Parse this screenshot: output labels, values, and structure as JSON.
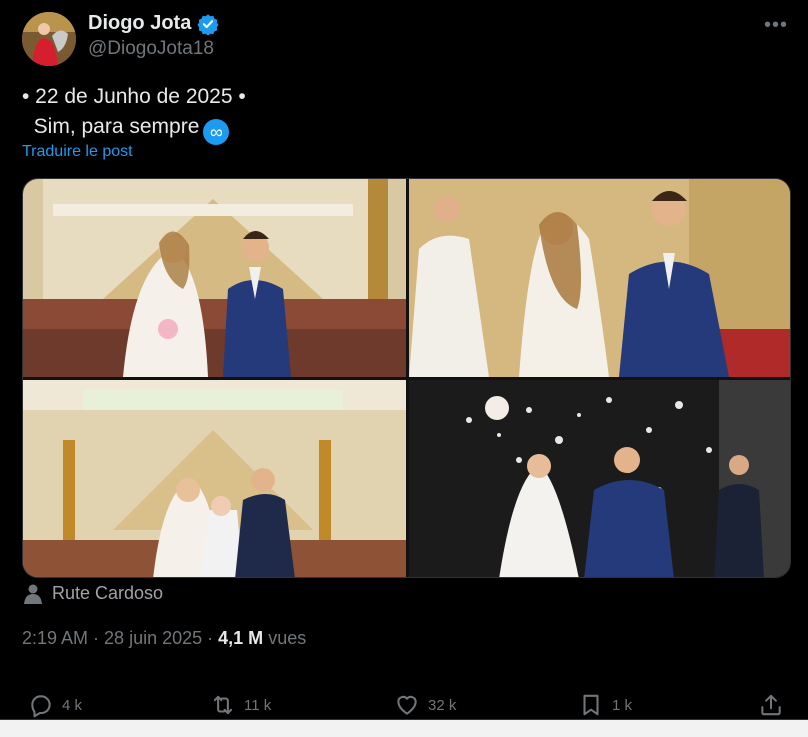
{
  "author": {
    "display_name": "Diogo Jota",
    "handle": "@DiogoJota18",
    "verified_icon": "verified-badge-icon"
  },
  "post": {
    "line1": "• 22 de Junho de 2025 •",
    "line2": "Sim, para sempre",
    "emoji_icon": "infinity-icon",
    "translate_label": "Traduire le post"
  },
  "media": {
    "photo_count": 4,
    "tagged_person": "Rute Cardoso"
  },
  "meta": {
    "time": "2:19 AM",
    "date": "28 juin 2025",
    "views_count": "4,1 M",
    "views_label": "vues"
  },
  "actions": {
    "replies": "4 k",
    "reposts": "11 k",
    "likes": "32 k",
    "bookmarks": "1 k"
  },
  "colors": {
    "background": "#000000",
    "accent": "#1d9bf0",
    "muted": "#71767b"
  }
}
